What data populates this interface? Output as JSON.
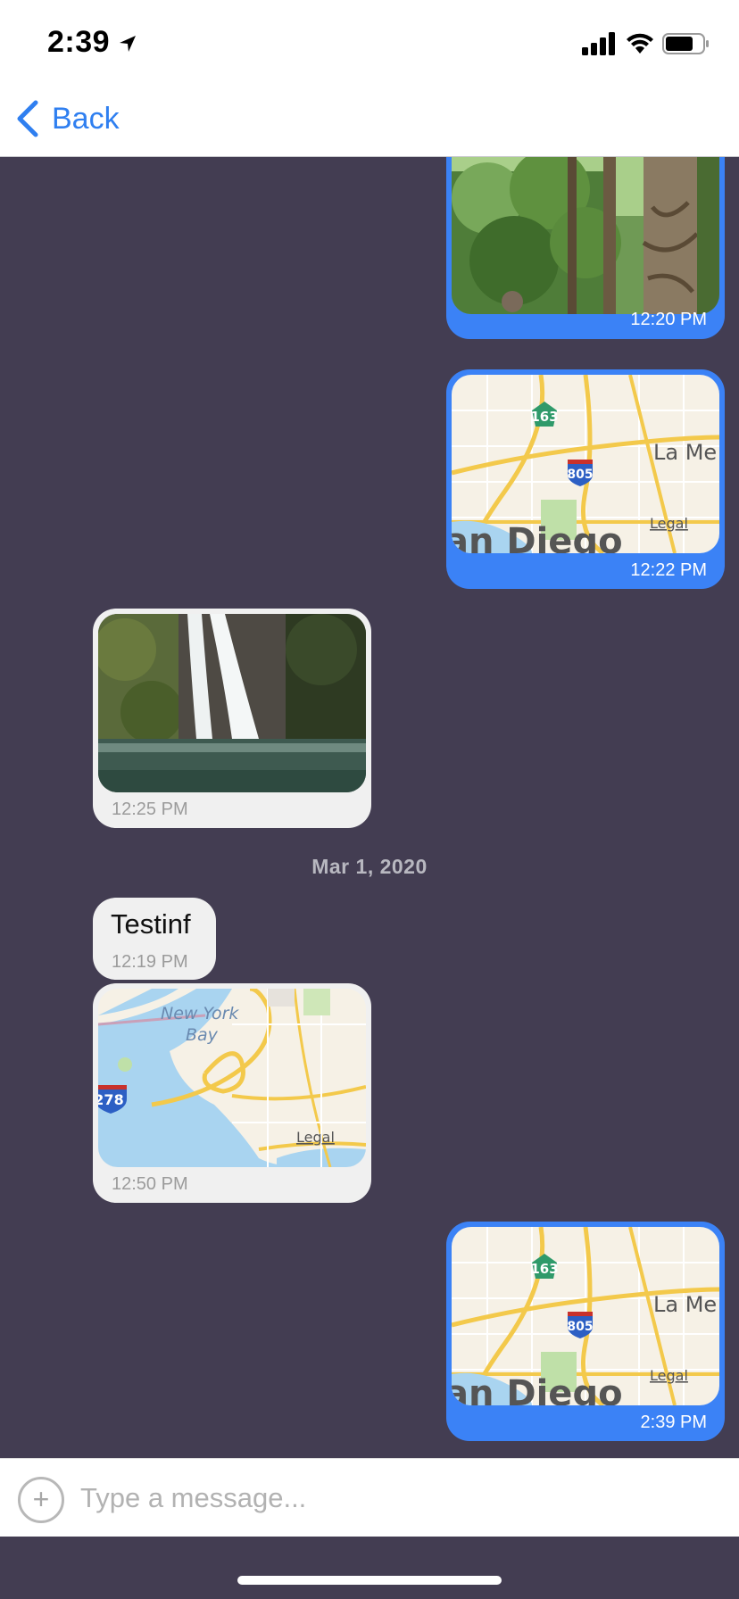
{
  "status_bar": {
    "time": "2:39"
  },
  "nav": {
    "back_label": "Back"
  },
  "messages": [
    {
      "direction": "out",
      "kind": "photo",
      "subject": "forest",
      "time": "12:20 PM"
    },
    {
      "direction": "out",
      "kind": "map",
      "map": {
        "labels": [
          "163",
          "805",
          "La Me",
          "Legal",
          "an Diego"
        ]
      },
      "time": "12:22 PM"
    },
    {
      "direction": "in",
      "kind": "photo",
      "subject": "waterfall",
      "time": "12:25 PM"
    },
    {
      "direction": "in",
      "kind": "text",
      "text": "Testinf",
      "time": "12:19 PM"
    },
    {
      "direction": "in",
      "kind": "map",
      "map": {
        "labels": [
          "New York",
          "Bay",
          "278",
          "Legal"
        ]
      },
      "time": "12:50 PM"
    },
    {
      "direction": "out",
      "kind": "map",
      "map": {
        "labels": [
          "163",
          "805",
          "La Me",
          "Legal",
          "an Diego"
        ]
      },
      "time": "2:39 PM"
    }
  ],
  "date_separator": "Mar 1, 2020",
  "composer": {
    "placeholder": "Type a message..."
  },
  "colors": {
    "chat_background": "#433d52",
    "outgoing_bubble": "#3b82f6",
    "incoming_bubble": "#f0f0f0",
    "accent": "#2f7ff0"
  }
}
